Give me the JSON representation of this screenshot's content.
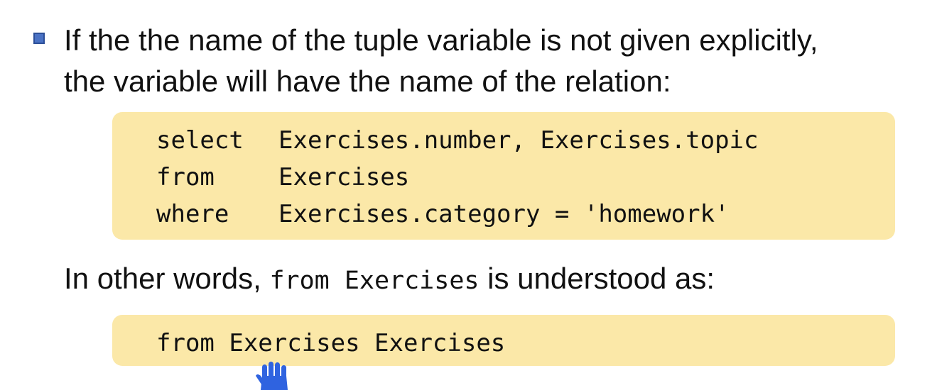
{
  "bullet": {
    "line1": "If the the name of the tuple variable is not given explicitly,",
    "line2": "the variable will have the name of the relation:"
  },
  "code_block_1": {
    "lines": [
      {
        "keyword": "select",
        "rest": "Exercises.number, Exercises.topic"
      },
      {
        "keyword": "from",
        "rest": "Exercises"
      },
      {
        "keyword": "where",
        "rest": "Exercises.category = 'homework'"
      }
    ]
  },
  "explanation": {
    "prefix": "In other words, ",
    "code": "from Exercises",
    "suffix": " is understood as:"
  },
  "code_block_2": {
    "line": "from Exercises Exercises"
  },
  "colors": {
    "code_background": "#fbe8a8",
    "bullet": "#4a72c4",
    "pointer": "#2f63e0"
  },
  "icons": {
    "pointer": "hand-pointer-icon"
  }
}
